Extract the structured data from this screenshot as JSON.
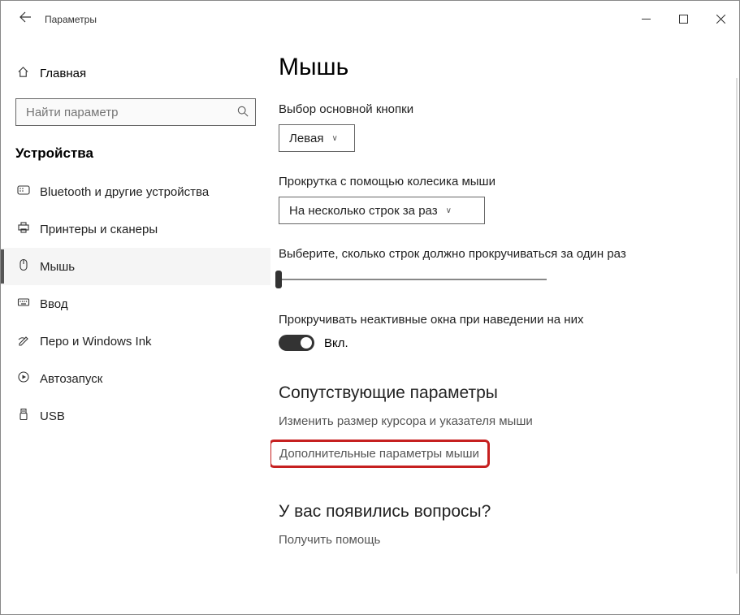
{
  "titlebar": {
    "title": "Параметры"
  },
  "sidebar": {
    "home": "Главная",
    "search_placeholder": "Найти параметр",
    "category": "Устройства",
    "items": [
      {
        "icon": "bluetooth-icon",
        "label": "Bluetooth и другие устройства"
      },
      {
        "icon": "printer-icon",
        "label": "Принтеры и сканеры"
      },
      {
        "icon": "mouse-icon",
        "label": "Мышь"
      },
      {
        "icon": "keyboard-icon",
        "label": "Ввод"
      },
      {
        "icon": "pen-icon",
        "label": "Перо и Windows Ink"
      },
      {
        "icon": "autoplay-icon",
        "label": "Автозапуск"
      },
      {
        "icon": "usb-icon",
        "label": "USB"
      }
    ],
    "active_index": 2
  },
  "content": {
    "heading": "Мышь",
    "primary_btn_label": "Выбор основной кнопки",
    "primary_btn_value": "Левая",
    "scroll_wheel_label": "Прокрутка с помощью колесика мыши",
    "scroll_wheel_value": "На несколько строк за раз",
    "lines_label": "Выберите, сколько строк должно прокручиваться за один раз",
    "inactive_scroll_label": "Прокручивать неактивные окна при наведении на них",
    "toggle_on": "Вкл.",
    "related_heading": "Сопутствующие параметры",
    "related_link1": "Изменить размер курсора и указателя мыши",
    "related_link2": "Дополнительные параметры мыши",
    "help_heading": "У вас появились вопросы?",
    "help_link": "Получить помощь"
  }
}
